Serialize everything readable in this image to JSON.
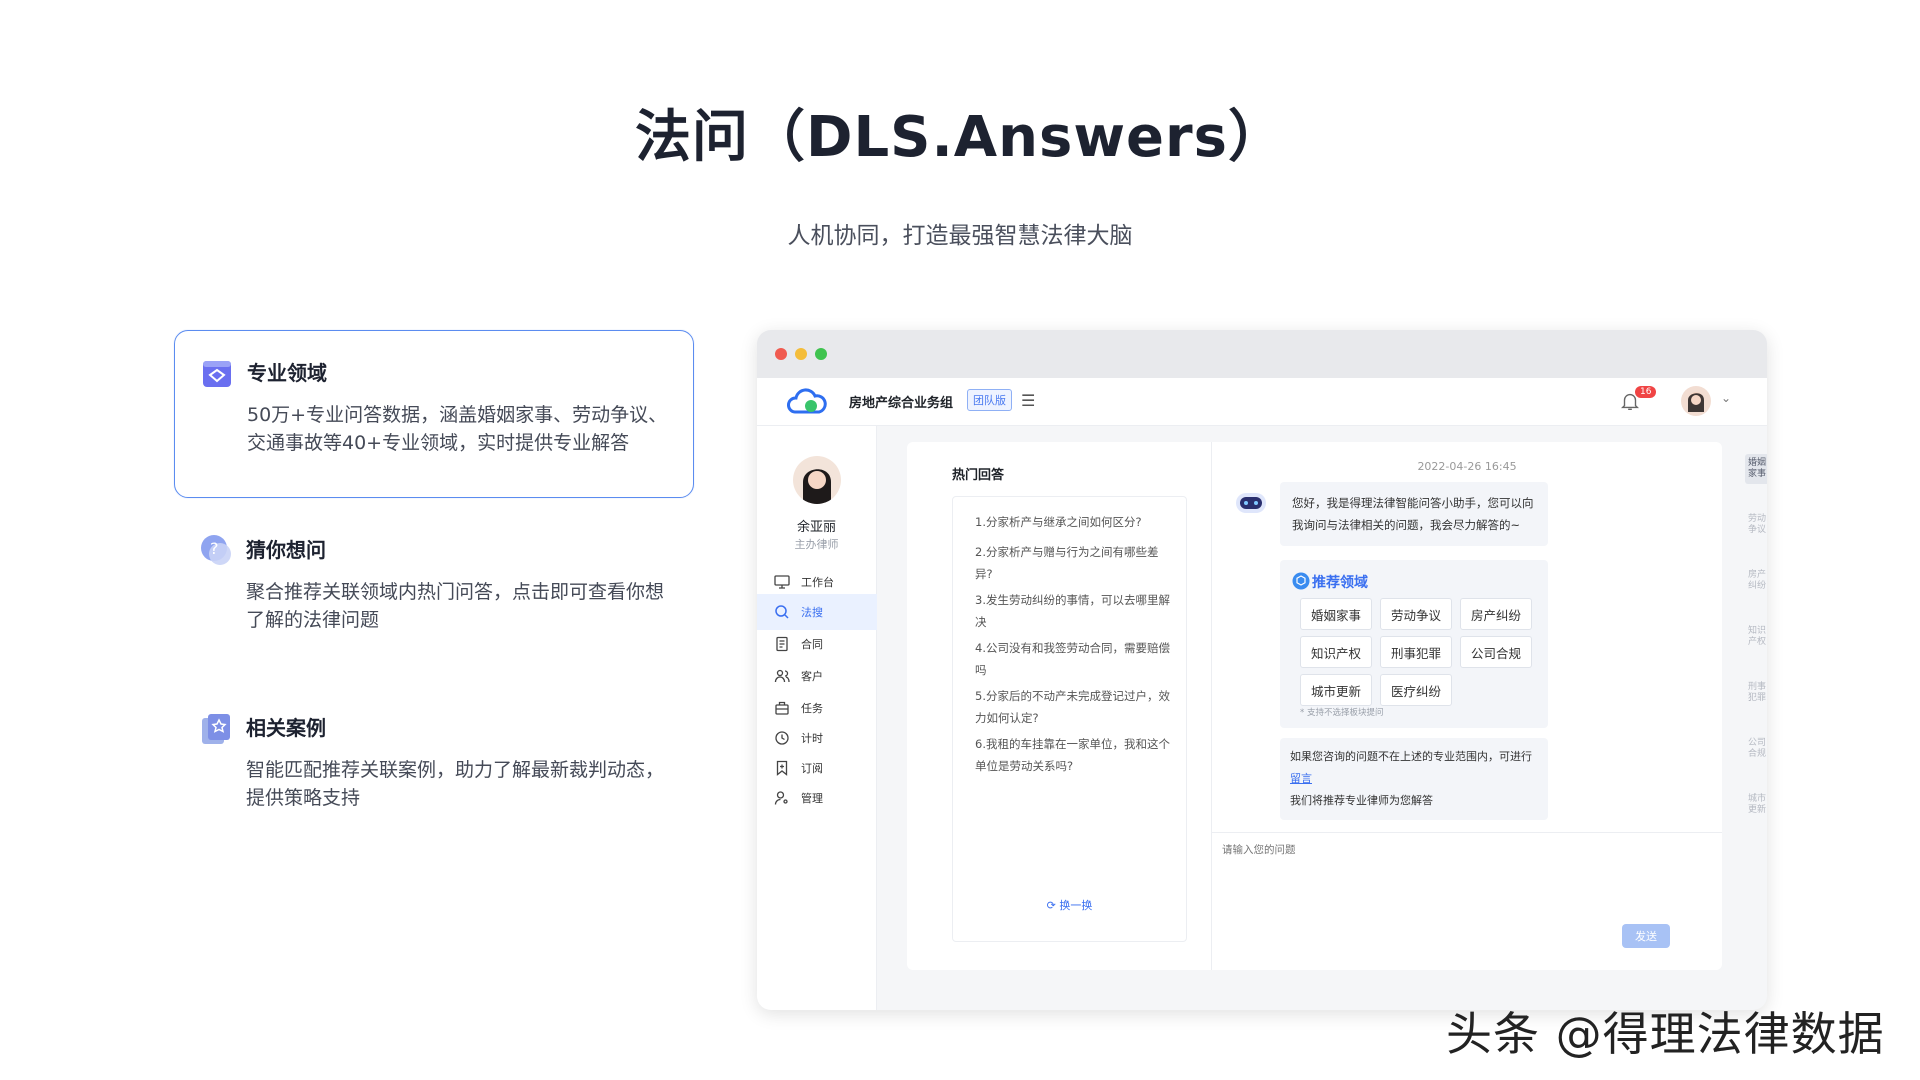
{
  "page": {
    "title": "法问（DLS.Answers）",
    "subtitle": "人机协同，打造最强智慧法律大脑"
  },
  "features": [
    {
      "title": "专业领域",
      "desc": "50万+专业问答数据，涵盖婚姻家事、劳动争议、交通事故等40+专业领域，实时提供专业解答",
      "icon": "book-heart-icon",
      "active": true
    },
    {
      "title": "猜你想问",
      "desc": "聚合推荐关联领域内热门问答，点击即可查看你想了解的法律问题",
      "icon": "question-bubble-icon",
      "active": false
    },
    {
      "title": "相关案例",
      "desc": "智能匹配推荐关联案例，助力了解最新裁判动态，提供策略支持",
      "icon": "star-document-icon",
      "active": false
    }
  ],
  "app": {
    "team_name": "房地产综合业务组",
    "team_badge": "团队版",
    "notification_count": "16",
    "user": {
      "name": "余亚丽",
      "role": "主办律师"
    },
    "nav": [
      {
        "label": "工作台",
        "icon": "monitor-icon",
        "selected": false
      },
      {
        "label": "法搜",
        "icon": "search-icon",
        "selected": true
      },
      {
        "label": "合同",
        "icon": "document-icon",
        "selected": false
      },
      {
        "label": "客户",
        "icon": "users-icon",
        "selected": false
      },
      {
        "label": "任务",
        "icon": "briefcase-icon",
        "selected": false
      },
      {
        "label": "计时",
        "icon": "clock-icon",
        "selected": false
      },
      {
        "label": "订阅",
        "icon": "bookmark-icon",
        "selected": false
      },
      {
        "label": "管理",
        "icon": "user-settings-icon",
        "selected": false
      }
    ],
    "hot": {
      "title": "热门回答",
      "questions": [
        "1.分家析产与继承之间如何区分?",
        "2.分家析产与赠与行为之间有哪些差异?",
        "3.发生劳动纠纷的事情，可以去哪里解决",
        "4.公司没有和我签劳动合同，需要赔偿吗",
        "5.分家后的不动产未完成登记过户，效力如何认定?",
        "6.我租的车挂靠在一家单位，我和这个单位是劳动关系吗?"
      ],
      "swap_label": "换一换"
    },
    "chat": {
      "timestamp": "2022-04-26 16:45",
      "greeting": "您好，我是得理法律智能问答小助手，您可以向我询问与法律相关的问题，我会尽力解答的~",
      "recommend_title": "推荐领域",
      "tags": [
        "婚姻家事",
        "劳动争议",
        "房产纠纷",
        "知识产权",
        "刑事犯罪",
        "公司合规",
        "城市更新",
        "医疗纠纷"
      ],
      "tag_note": "* 支持不选择板块提问",
      "followup_pre": "如果您咨询的问题不在上述的专业范围内，可进行",
      "followup_link": "留言",
      "followup_post": "我们将推荐专业律师为您解答",
      "input_placeholder": "请输入您的问题",
      "send_label": "发送"
    },
    "vertical_tabs": [
      "婚姻家事",
      "劳动争议",
      "房产纠纷",
      "知识产权",
      "刑事犯罪",
      "公司合规",
      "城市更新"
    ]
  },
  "watermark": "头条 @得理法律数据",
  "colors": {
    "accent": "#3a6ff0",
    "active_border": "#5b8cf0",
    "send_disabled": "#a8c2f5"
  }
}
